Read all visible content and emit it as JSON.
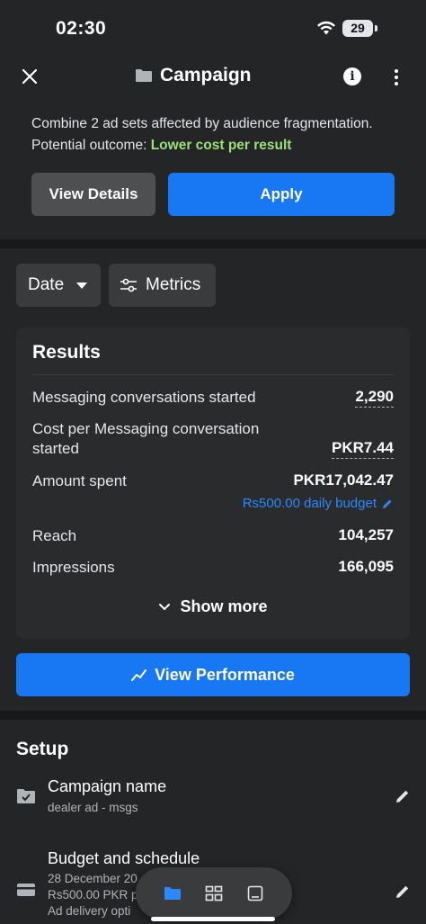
{
  "status_bar": {
    "time": "02:30",
    "battery": "29"
  },
  "header": {
    "title": "Campaign"
  },
  "recommendation": {
    "line1": "Combine 2 ad sets affected by audience fragmentation.",
    "outcome_label": "Potential outcome:",
    "outcome_value": "Lower cost per result",
    "view_details_label": "View Details",
    "apply_label": "Apply"
  },
  "filters": {
    "date_label": "Date",
    "metrics_label": "Metrics"
  },
  "results": {
    "title": "Results",
    "rows": [
      {
        "label": "Messaging conversations started",
        "value": "2,290"
      },
      {
        "label": "Cost per Messaging conversation started",
        "value": "PKR7.44"
      },
      {
        "label": "Amount spent",
        "value": "PKR17,042.47",
        "sub": "Rs500.00 daily budget"
      },
      {
        "label": "Reach",
        "value": "104,257"
      },
      {
        "label": "Impressions",
        "value": "166,095"
      }
    ],
    "show_more_label": "Show more"
  },
  "view_performance_label": "View Performance",
  "setup": {
    "title": "Setup",
    "campaign_name": {
      "title": "Campaign name",
      "value": "dealer ad - msgs"
    },
    "budget": {
      "title": "Budget and schedule",
      "line1": "28 December 20",
      "line2": "Rs500.00 PKR p",
      "line3": "Ad delivery opti"
    }
  },
  "colors": {
    "accent": "#1877f2",
    "positive": "#9ee07c",
    "link": "#2d88ff",
    "background": "#242526"
  },
  "icons": [
    "close-icon",
    "folder-icon",
    "info-icon",
    "more-icon",
    "edit-icon",
    "sliders-icon",
    "chevron-down-icon",
    "chart-line-icon",
    "folder-check-icon",
    "card-icon",
    "layout-icon",
    "tablet-icon"
  ]
}
